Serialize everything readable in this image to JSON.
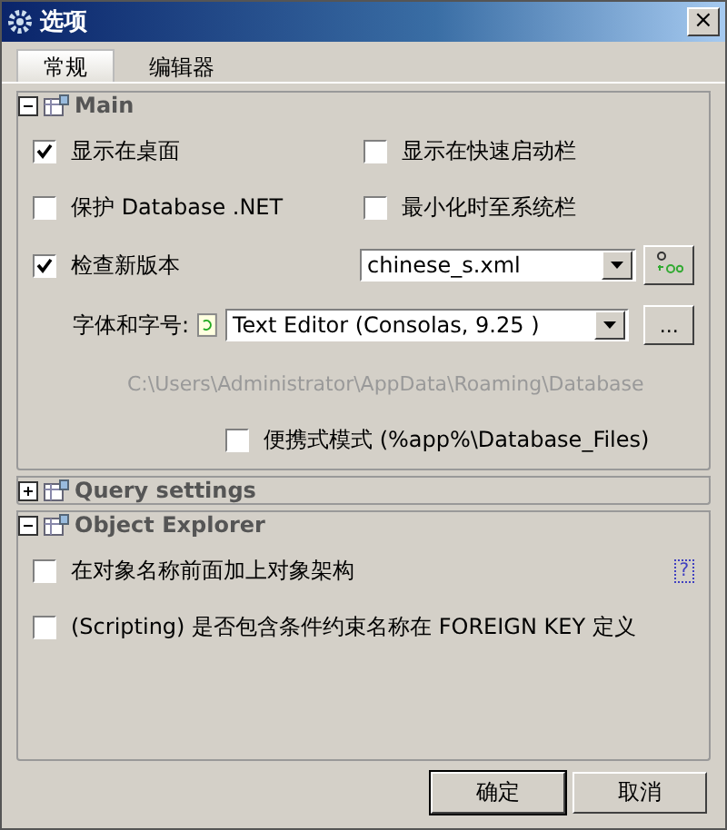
{
  "window": {
    "title": "选项",
    "close": "×"
  },
  "tabs": [
    {
      "label": "常规",
      "selected": true
    },
    {
      "label": "编辑器",
      "selected": false
    }
  ],
  "sections": [
    {
      "title": "Main",
      "expanded": true,
      "rows": [
        {
          "kind": "pair",
          "items": [
            {
              "label": "显示在桌面",
              "checked": true
            },
            {
              "label": "显示在快速启动栏",
              "checked": false
            }
          ]
        },
        {
          "kind": "pair",
          "items": [
            {
              "label": "保护 Database .NET",
              "checked": false
            },
            {
              "label": "最小化时至系统栏",
              "checked": false
            }
          ]
        },
        {
          "kind": "check_select",
          "label": "检查新版本",
          "checked": true,
          "value": "chinese_s.xml"
        },
        {
          "kind": "font",
          "label": "字体和字号:",
          "value": "Text Editor (Consolas, 9.25 )",
          "button": "..."
        },
        {
          "kind": "path",
          "text": "C:\\Users\\Administrator\\AppData\\Roaming\\Database"
        },
        {
          "kind": "indent_check",
          "label": "便携式模式 (%app%\\Database_Files)",
          "checked": false
        }
      ]
    },
    {
      "title": "Query settings",
      "expanded": false
    },
    {
      "title": "Object Explorer",
      "expanded": true,
      "rows": [
        {
          "kind": "check",
          "label": "在对象名称前面加上对象架构",
          "checked": false,
          "help": "?"
        },
        {
          "kind": "check",
          "label": "(Scripting) 是否包含条件约束名称在 FOREIGN KEY 定义",
          "checked": false
        }
      ]
    }
  ],
  "buttons": [
    {
      "label": "确定",
      "default": true
    },
    {
      "label": "取消",
      "default": false
    }
  ]
}
